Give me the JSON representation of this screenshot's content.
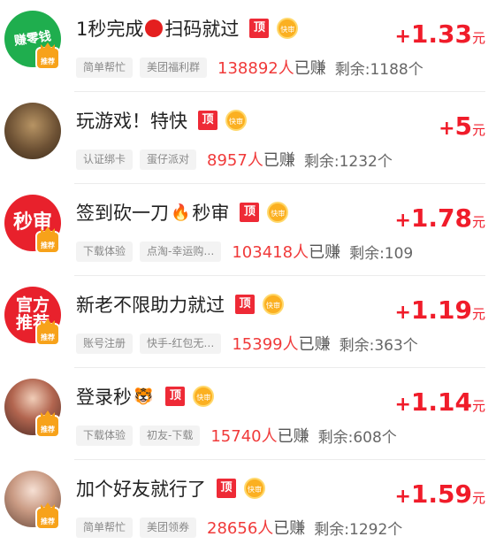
{
  "tasks": [
    {
      "avatar_text": "赚零钱",
      "crown_label": "推荐",
      "title_pre": "1秒完成",
      "title_icon": "red-circle",
      "title_post": "扫码就过",
      "top_badge": "顶",
      "fast_badge": "快审",
      "tag1": "简单帮忙",
      "tag2": "美团福利群",
      "earned": "138892人",
      "earned_suffix": "已赚",
      "remaining": "剩余:1188个",
      "reward_plus": "+",
      "reward": "1.33",
      "reward_unit": "元"
    },
    {
      "avatar_text": "",
      "crown_label": "",
      "title_pre": "玩游戏！特快",
      "title_icon": "",
      "title_post": "",
      "top_badge": "顶",
      "fast_badge": "快审",
      "tag1": "认证绑卡",
      "tag2": "蛋仔派对",
      "earned": "8957人",
      "earned_suffix": "已赚",
      "remaining": "剩余:1232个",
      "reward_plus": "+",
      "reward": "5",
      "reward_unit": "元"
    },
    {
      "avatar_text": "秒审",
      "crown_label": "推荐",
      "title_pre": "签到砍一刀",
      "title_icon": "fire",
      "title_post": "秒审",
      "top_badge": "顶",
      "fast_badge": "快审",
      "tag1": "下载体验",
      "tag2": "点淘-幸运购…",
      "earned": "103418人",
      "earned_suffix": "已赚",
      "remaining": "剩余:109",
      "reward_plus": "+",
      "reward": "1.78",
      "reward_unit": "元"
    },
    {
      "avatar_text": "官方推荐",
      "crown_label": "推荐",
      "title_pre": "新老不限助力就过",
      "title_icon": "",
      "title_post": "",
      "top_badge": "顶",
      "fast_badge": "快审",
      "tag1": "账号注册",
      "tag2": "快手-红包无…",
      "earned": "15399人",
      "earned_suffix": "已赚",
      "remaining": "剩余:363个",
      "reward_plus": "+",
      "reward": "1.19",
      "reward_unit": "元"
    },
    {
      "avatar_text": "",
      "crown_label": "推荐",
      "title_pre": "登录秒",
      "title_icon": "tiger",
      "title_post": "",
      "top_badge": "顶",
      "fast_badge": "快审",
      "tag1": "下载体验",
      "tag2": "初友-下载",
      "earned": "15740人",
      "earned_suffix": "已赚",
      "remaining": "剩余:608个",
      "reward_plus": "+",
      "reward": "1.14",
      "reward_unit": "元"
    },
    {
      "avatar_text": "",
      "crown_label": "推荐",
      "title_pre": "加个好友就行了",
      "title_icon": "",
      "title_post": "",
      "top_badge": "顶",
      "fast_badge": "快审",
      "tag1": "简单帮忙",
      "tag2": "美团领券",
      "earned": "28656人",
      "earned_suffix": "已赚",
      "remaining": "剩余:1292个",
      "reward_plus": "+",
      "reward": "1.59",
      "reward_unit": "元"
    }
  ],
  "colors": {
    "accent_red": "#f01c2a",
    "badge_orange": "#fbb021"
  }
}
